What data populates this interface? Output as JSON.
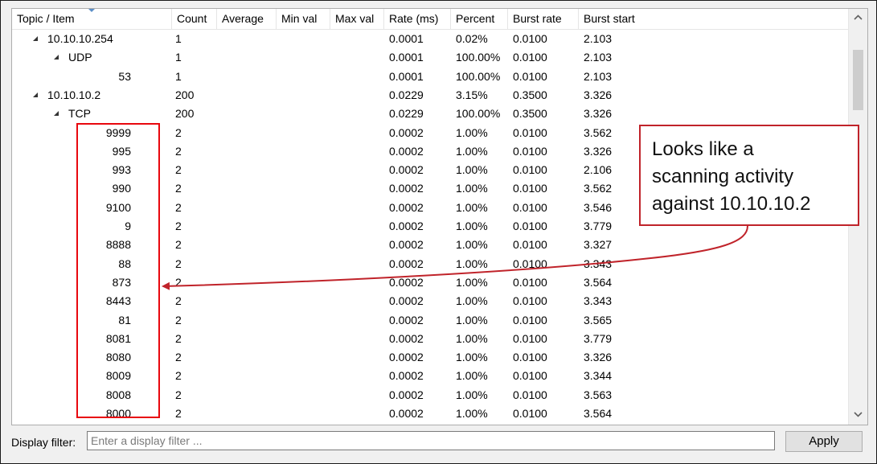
{
  "columns": [
    "Topic / Item",
    "Count",
    "Average",
    "Min val",
    "Max val",
    "Rate (ms)",
    "Percent",
    "Burst rate",
    "Burst start"
  ],
  "rows": [
    {
      "item": "10.10.10.254",
      "level": 1,
      "expandable": true,
      "count": "1",
      "rate": "0.0001",
      "percent": "0.02%",
      "burst_rate": "0.0100",
      "burst_start": "2.103"
    },
    {
      "item": "UDP",
      "level": 2,
      "expandable": true,
      "count": "1",
      "rate": "0.0001",
      "percent": "100.00%",
      "burst_rate": "0.0100",
      "burst_start": "2.103"
    },
    {
      "item": "53",
      "level": 3,
      "expandable": false,
      "count": "1",
      "rate": "0.0001",
      "percent": "100.00%",
      "burst_rate": "0.0100",
      "burst_start": "2.103"
    },
    {
      "item": "10.10.10.2",
      "level": 1,
      "expandable": true,
      "count": "200",
      "rate": "0.0229",
      "percent": "3.15%",
      "burst_rate": "0.3500",
      "burst_start": "3.326"
    },
    {
      "item": "TCP",
      "level": 2,
      "expandable": true,
      "count": "200",
      "rate": "0.0229",
      "percent": "100.00%",
      "burst_rate": "0.3500",
      "burst_start": "3.326"
    },
    {
      "item": "9999",
      "level": 3,
      "expandable": false,
      "count": "2",
      "rate": "0.0002",
      "percent": "1.00%",
      "burst_rate": "0.0100",
      "burst_start": "3.562"
    },
    {
      "item": "995",
      "level": 3,
      "expandable": false,
      "count": "2",
      "rate": "0.0002",
      "percent": "1.00%",
      "burst_rate": "0.0100",
      "burst_start": "3.326"
    },
    {
      "item": "993",
      "level": 3,
      "expandable": false,
      "count": "2",
      "rate": "0.0002",
      "percent": "1.00%",
      "burst_rate": "0.0100",
      "burst_start": "2.106"
    },
    {
      "item": "990",
      "level": 3,
      "expandable": false,
      "count": "2",
      "rate": "0.0002",
      "percent": "1.00%",
      "burst_rate": "0.0100",
      "burst_start": "3.562"
    },
    {
      "item": "9100",
      "level": 3,
      "expandable": false,
      "count": "2",
      "rate": "0.0002",
      "percent": "1.00%",
      "burst_rate": "0.0100",
      "burst_start": "3.546"
    },
    {
      "item": "9",
      "level": 3,
      "expandable": false,
      "count": "2",
      "rate": "0.0002",
      "percent": "1.00%",
      "burst_rate": "0.0100",
      "burst_start": "3.779"
    },
    {
      "item": "8888",
      "level": 3,
      "expandable": false,
      "count": "2",
      "rate": "0.0002",
      "percent": "1.00%",
      "burst_rate": "0.0100",
      "burst_start": "3.327"
    },
    {
      "item": "88",
      "level": 3,
      "expandable": false,
      "count": "2",
      "rate": "0.0002",
      "percent": "1.00%",
      "burst_rate": "0.0100",
      "burst_start": "3.343"
    },
    {
      "item": "873",
      "level": 3,
      "expandable": false,
      "count": "2",
      "rate": "0.0002",
      "percent": "1.00%",
      "burst_rate": "0.0100",
      "burst_start": "3.564"
    },
    {
      "item": "8443",
      "level": 3,
      "expandable": false,
      "count": "2",
      "rate": "0.0002",
      "percent": "1.00%",
      "burst_rate": "0.0100",
      "burst_start": "3.343"
    },
    {
      "item": "81",
      "level": 3,
      "expandable": false,
      "count": "2",
      "rate": "0.0002",
      "percent": "1.00%",
      "burst_rate": "0.0100",
      "burst_start": "3.565"
    },
    {
      "item": "8081",
      "level": 3,
      "expandable": false,
      "count": "2",
      "rate": "0.0002",
      "percent": "1.00%",
      "burst_rate": "0.0100",
      "burst_start": "3.779"
    },
    {
      "item": "8080",
      "level": 3,
      "expandable": false,
      "count": "2",
      "rate": "0.0002",
      "percent": "1.00%",
      "burst_rate": "0.0100",
      "burst_start": "3.326"
    },
    {
      "item": "8009",
      "level": 3,
      "expandable": false,
      "count": "2",
      "rate": "0.0002",
      "percent": "1.00%",
      "burst_rate": "0.0100",
      "burst_start": "3.344"
    },
    {
      "item": "8008",
      "level": 3,
      "expandable": false,
      "count": "2",
      "rate": "0.0002",
      "percent": "1.00%",
      "burst_rate": "0.0100",
      "burst_start": "3.563"
    },
    {
      "item": "8000",
      "level": 3,
      "expandable": false,
      "count": "2",
      "rate": "0.0002",
      "percent": "1.00%",
      "burst_rate": "0.0100",
      "burst_start": "3.564"
    }
  ],
  "filter": {
    "label": "Display filter:",
    "placeholder": "Enter a display filter ...",
    "value": "",
    "apply_label": "Apply"
  },
  "annotation": {
    "lines": [
      "Looks like a",
      "scanning activity",
      "against 10.10.10.2"
    ],
    "color": "#c0232a"
  },
  "icons": {
    "expander": "expanded-triangle-icon",
    "scroll_up": "chevron-up-icon",
    "scroll_down": "chevron-down-icon",
    "sort": "sort-indicator-icon"
  }
}
